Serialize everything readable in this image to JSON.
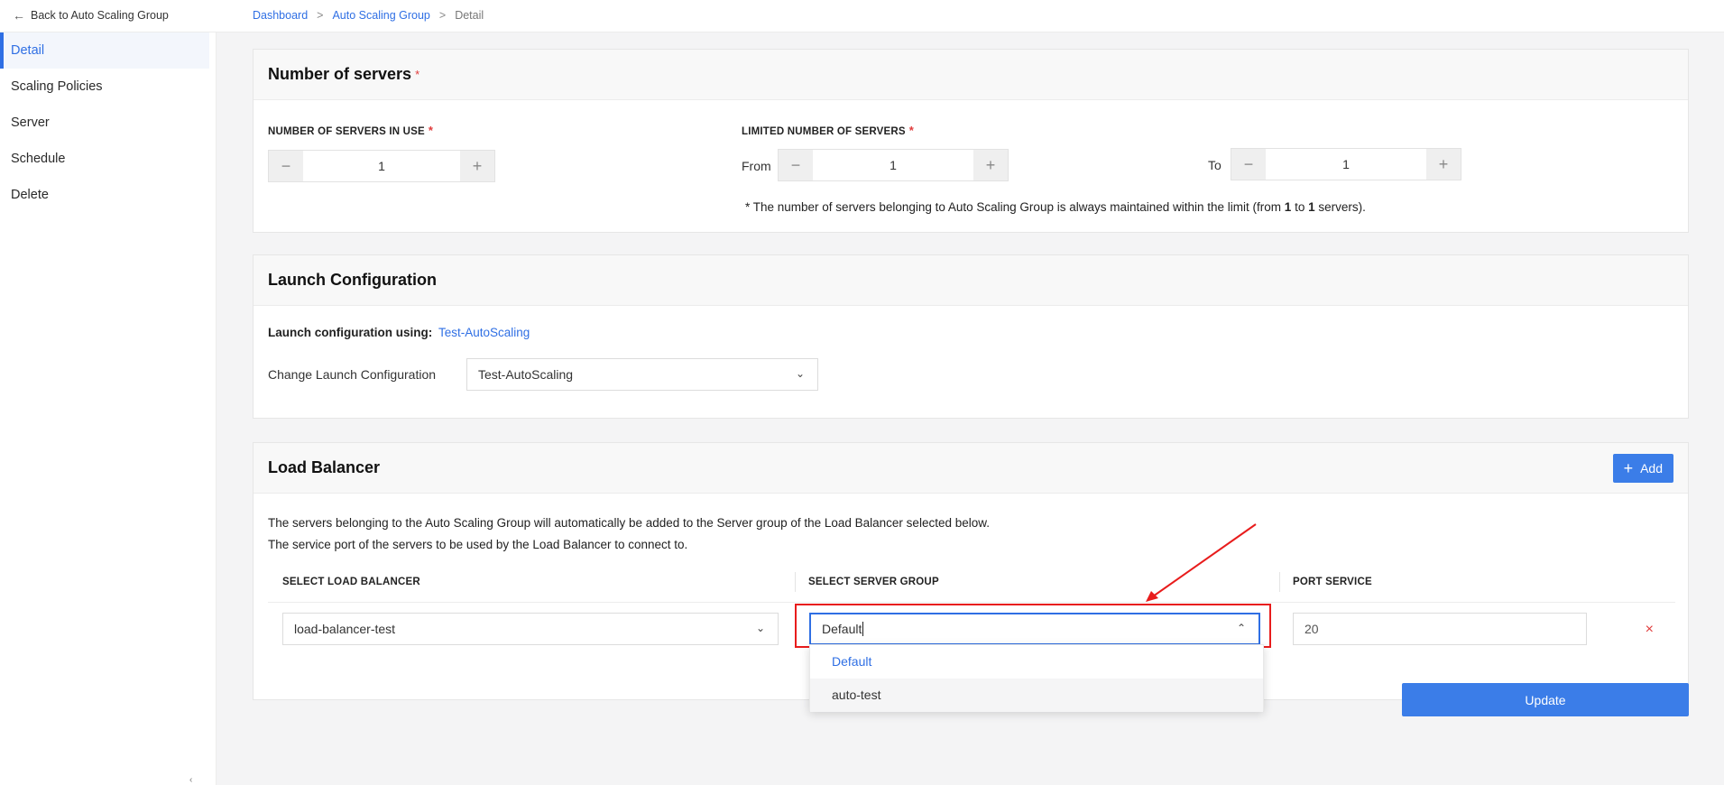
{
  "header": {
    "back_label": "Back to Auto Scaling Group",
    "breadcrumb": [
      "Dashboard",
      "Auto Scaling Group",
      "Detail"
    ],
    "breadcrumb_sep": ">"
  },
  "sidebar": {
    "items": [
      {
        "label": "Detail",
        "active": true
      },
      {
        "label": "Scaling Policies"
      },
      {
        "label": "Server"
      },
      {
        "label": "Schedule"
      },
      {
        "label": "Delete"
      }
    ],
    "collapse_icon": "chevron-left-icon"
  },
  "servers_card": {
    "title": "Number of servers",
    "required_mark": "*",
    "in_use_label": "NUMBER OF SERVERS IN USE",
    "in_use_value": "1",
    "limit_label": "LIMITED NUMBER OF SERVERS",
    "from_label": "From",
    "from_value": "1",
    "to_label": "To",
    "to_value": "1",
    "note_prefix": "* The number of servers belonging to Auto Scaling Group is always maintained within the limit (from ",
    "note_from": "1",
    "note_mid": " to ",
    "note_to": "1",
    "note_suffix": " servers).",
    "minus_glyph": "−",
    "plus_glyph": "+"
  },
  "launch_card": {
    "title": "Launch Configuration",
    "using_label": "Launch configuration using:",
    "using_value": "Test-AutoScaling",
    "change_label": "Change Launch Configuration",
    "selected": "Test-AutoScaling"
  },
  "lb_card": {
    "title": "Load Balancer",
    "add_label": "Add",
    "desc_line1": "The servers belonging to the Auto Scaling Group will automatically be added to the Server group of the Load Balancer selected below.",
    "desc_line2": "The service port of the servers to be used by the Load Balancer to connect to.",
    "col_lb": "SELECT LOAD BALANCER",
    "col_group": "SELECT SERVER GROUP",
    "col_port": "PORT SERVICE",
    "row": {
      "load_balancer": "load-balancer-test",
      "server_group": "Default",
      "port": "20"
    },
    "dropdown_options": [
      "Default",
      "auto-test"
    ],
    "remove_glyph": "×"
  },
  "update_label": "Update",
  "colors": {
    "accent": "#2f6fe4",
    "button": "#3b7de8",
    "highlight": "#e81c1c",
    "required": "#e03b3b"
  }
}
